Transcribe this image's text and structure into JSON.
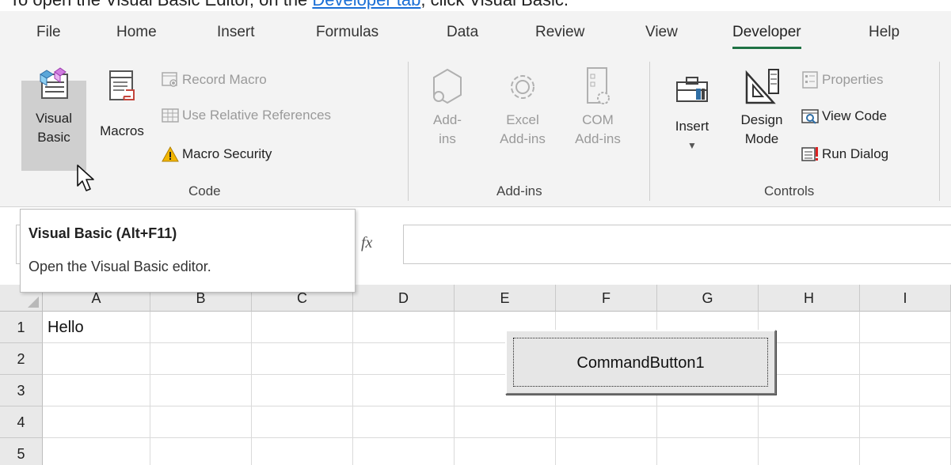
{
  "caption": {
    "prefix": "To open the Visual Basic Editor, on the ",
    "link": "Developer tab",
    "suffix": ", click Visual Basic."
  },
  "menu": [
    "File",
    "Home",
    "Insert",
    "Formulas",
    "Data",
    "Review",
    "View",
    "Developer",
    "Help"
  ],
  "active_menu": "Developer",
  "accent_color": "#1f7244",
  "ribbon": {
    "code": {
      "label": "Code",
      "visual_basic": [
        "Visual",
        "Basic"
      ],
      "macros": "Macros",
      "record_macro": "Record Macro",
      "use_relative": "Use Relative References",
      "macro_security": "Macro Security"
    },
    "addins": {
      "label": "Add-ins",
      "addins_btn": [
        "Add-",
        "ins"
      ],
      "excel_addins": [
        "Excel",
        "Add-ins"
      ],
      "com_addins": [
        "COM",
        "Add-ins"
      ]
    },
    "controls": {
      "label": "Controls",
      "insert": "Insert",
      "design_mode": [
        "Design",
        "Mode"
      ],
      "properties": "Properties",
      "view_code": "View Code",
      "run_dialog": "Run Dialog"
    }
  },
  "formula_bar": {
    "fx": "fx",
    "value": ""
  },
  "tooltip": {
    "title": "Visual Basic (Alt+F11)",
    "description": "Open the Visual Basic editor."
  },
  "columns": [
    "A",
    "B",
    "C",
    "D",
    "E",
    "F",
    "G",
    "H",
    "I"
  ],
  "rows": [
    "1",
    "2",
    "3",
    "4",
    "5"
  ],
  "cells": {
    "A1": "Hello"
  },
  "command_button": "CommandButton1",
  "icons": [
    "visual-basic-icon",
    "macros-icon",
    "record-macro-icon",
    "relative-references-icon",
    "warning-icon",
    "addins-icon",
    "gear-icon",
    "com-addins-icon",
    "toolbox-icon",
    "design-mode-icon",
    "properties-icon",
    "view-code-icon",
    "run-dialog-icon",
    "mouse-cursor-icon"
  ]
}
